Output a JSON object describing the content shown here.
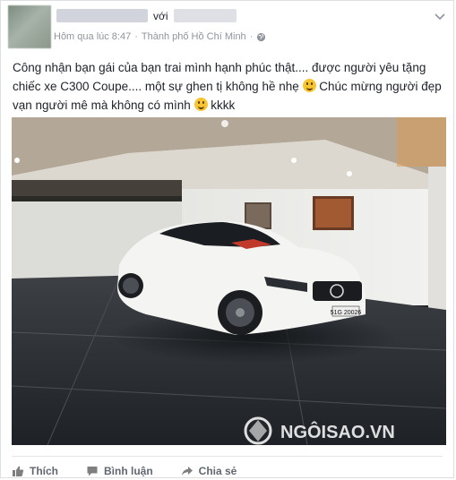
{
  "post": {
    "with_label": "với",
    "timestamp": "Hôm qua lúc 8:47",
    "separator": "·",
    "location": "Thành phố Hồ Chí Minh",
    "separator2": "·",
    "caption_part1": "Công nhận bạn gái của bạn trai mình hạnh phúc thật.... được người yêu tặng chiếc xe C300 Coupe.... một sự ghen tị không hề nhẹ ",
    "caption_part2": " Chúc mừng người đẹp vạn người mê mà không có mình ",
    "caption_part3": " kkkk",
    "photo_plate": "51G 20026",
    "watermark": "NGÔISAO.VN"
  },
  "actions": {
    "like": "Thích",
    "comment": "Bình luận",
    "share": "Chia sẻ"
  },
  "colors": {
    "meta_text": "#90949c",
    "action_text": "#616770",
    "car": "#f4f4f2"
  },
  "icons": {
    "chevron": "chevron-down-icon",
    "globe": "globe-icon",
    "like": "thumbs-up-icon",
    "comment": "comment-icon",
    "share": "share-arrow-icon"
  }
}
